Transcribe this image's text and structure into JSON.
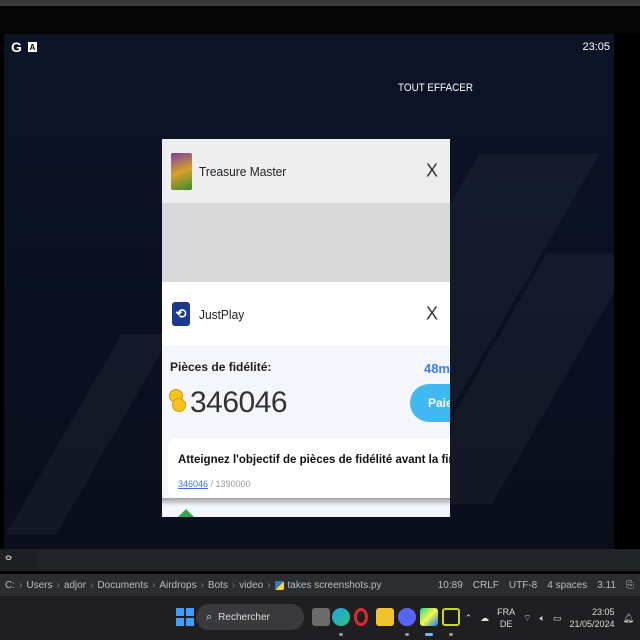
{
  "phone": {
    "status_time": "23:05",
    "clear_all": "TOUT EFFACER"
  },
  "cards": [
    {
      "app_name": "Treasure Master",
      "close": "X"
    },
    {
      "app_name": "JustPlay",
      "close": "X",
      "loyalty_label": "Pièces de fidélité:",
      "coins": "346046",
      "timer": "48m",
      "pay_label": "Paie",
      "goal_text": "Atteignez l'objectif de pièces de fidélité avant la fin du décompt",
      "goal_progress_current": "346046",
      "goal_progress_rest": " / 1390000"
    }
  ],
  "ide": {
    "path": [
      "C:",
      "Users",
      "adjor",
      "Documents",
      "Airdrops",
      "Bots",
      "video",
      "takes screenshots.py"
    ],
    "cursor": "10:89",
    "line_ending": "CRLF",
    "encoding": "UTF-8",
    "indent": "4 spaces",
    "python": "3.11"
  },
  "taskbar": {
    "search_placeholder": "Rechercher",
    "lang_top": "FRA",
    "lang_bottom": "DE",
    "time": "23:05",
    "date": "21/05/2024"
  }
}
